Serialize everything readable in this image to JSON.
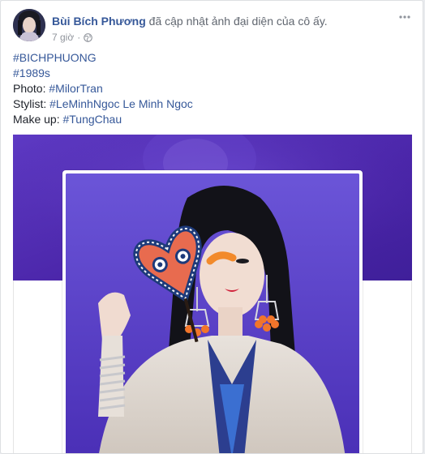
{
  "post": {
    "author": "Bùi Bích Phương",
    "action": "đã cập nhật ảnh đại diện của cô ấy.",
    "timestamp": "7 giờ",
    "separator": "·",
    "privacy_icon": "globe-icon",
    "options_icon": "more-options-icon"
  },
  "body": {
    "line1": {
      "tag": "#BICHPHUONG"
    },
    "line2": {
      "tag": "#1989s"
    },
    "line3": {
      "label": "Photo: ",
      "tag": "#MilorTran"
    },
    "line4": {
      "label": "Stylist: ",
      "tag": "#LeMinhNgoc Le Minh Ngoc"
    },
    "line5": {
      "label": "Make up: ",
      "tag": "#TungChau"
    }
  },
  "colors": {
    "link": "#365899",
    "cover_purple": "#4a25a8",
    "meta_gray": "#90949c"
  }
}
